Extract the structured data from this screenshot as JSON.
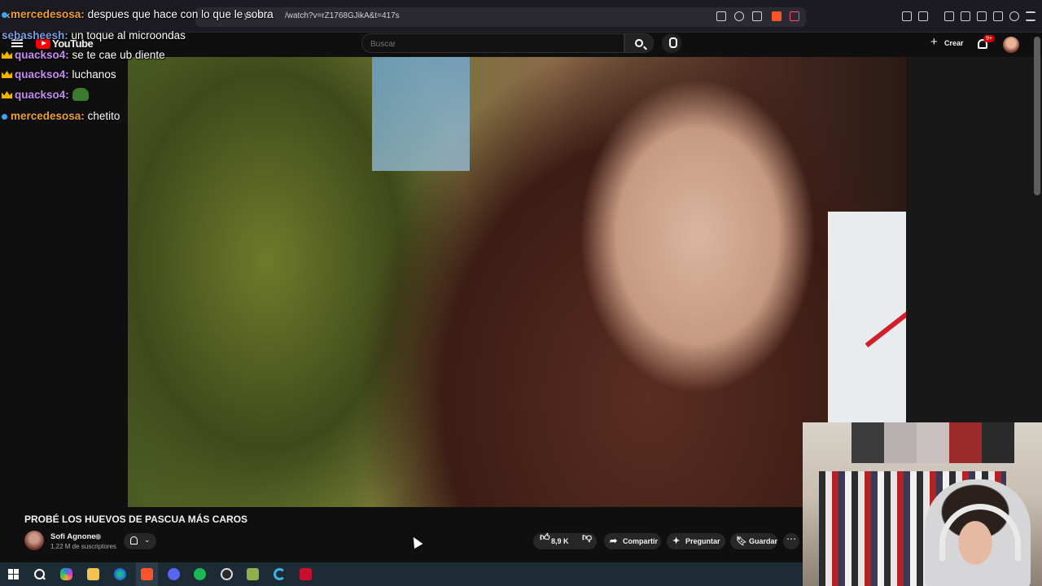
{
  "browser": {
    "url": "/watch?v=rZ1768GJikA&t=417s",
    "tab_text": "youtub"
  },
  "youtube": {
    "logo": "YouTube",
    "search_placeholder": "Buscar",
    "create_label": "Crear",
    "notification_badge": "9+"
  },
  "chat": {
    "messages": [
      {
        "user": "mercedesosa:",
        "text": " despues que hace con lo que le sobra",
        "color": "#f0a030",
        "badge": "dot"
      },
      {
        "user": "sebasheesh:",
        "text": " un toque al microondas",
        "color": "#7aa0e8",
        "badge": "none"
      },
      {
        "user": "quackso4:",
        "text": " se te cae ub diente",
        "color": "#c68cf2",
        "badge": "crown"
      },
      {
        "user": "quackso4:",
        "text": " luchanos",
        "color": "#c68cf2",
        "badge": "crown"
      },
      {
        "user": "quackso4:",
        "text": "",
        "color": "#c68cf2",
        "badge": "crown",
        "emote": true
      },
      {
        "user": "mercedesosa:",
        "text": " chetito",
        "color": "#f0a030",
        "badge": "dot"
      }
    ]
  },
  "video": {
    "title": "PROBÉ LOS HUEVOS DE PASCUA MÁS CAROS",
    "channel": "Sofi Agnone",
    "subscribers": "1,22 M de suscriptores",
    "likes": "8,9 K",
    "share_label": "Compartir",
    "ask_label": "Preguntar",
    "save_label": "Guardar"
  }
}
